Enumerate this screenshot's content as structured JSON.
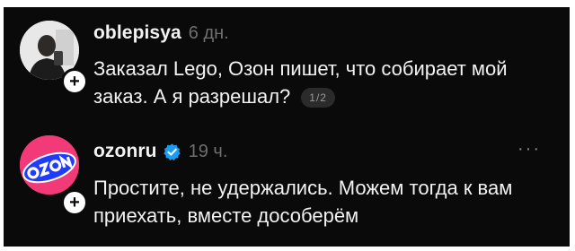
{
  "posts": [
    {
      "username": "oblepisya",
      "time": "6 дн.",
      "text": "Заказал Lego, Озон пишет, что собирает мой заказ. А я разрешал?",
      "page_indicator": "1/2",
      "follow_badge": "+",
      "avatar_icon": "user-photo-icon"
    },
    {
      "username": "ozonru",
      "verified": true,
      "time": "19 ч.",
      "text": "Простите, не удержались. Можем тогда к вам приехать, вместе дособерём",
      "more_label": "···",
      "follow_badge": "+",
      "avatar_icon": "ozon-logo-icon"
    }
  ],
  "colors": {
    "background": "#0a0a0a",
    "text_primary": "#f2f2f2",
    "text_secondary": "#6f6f6f",
    "verified_blue": "#1d9bf0",
    "ozon_pink": "#f33a78",
    "ozon_blue": "#1f3bff"
  }
}
